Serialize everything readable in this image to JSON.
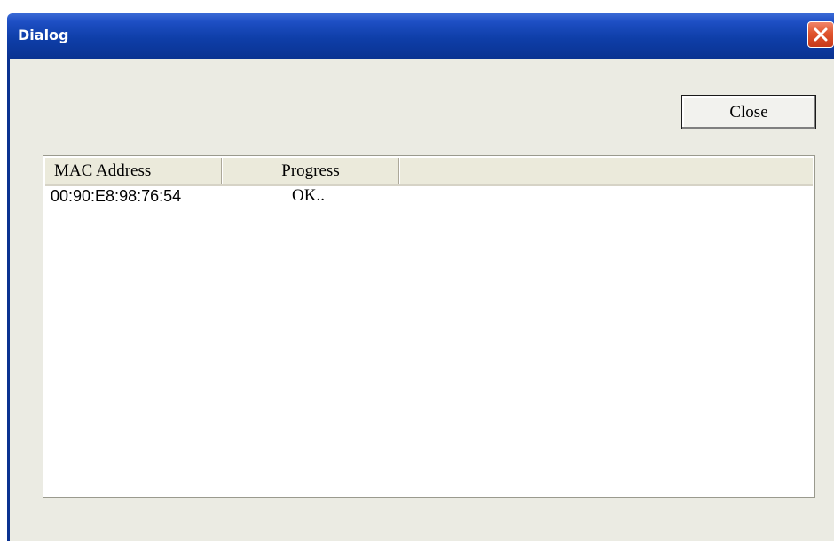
{
  "window": {
    "title": "Dialog",
    "close_icon": "close-x-icon",
    "colors": {
      "titlebar": "#0e3ea8",
      "close": "#e0542d",
      "client": "#ebebe3"
    }
  },
  "toolbar": {
    "close_label": "Close"
  },
  "table": {
    "columns": [
      "MAC Address",
      "Progress",
      ""
    ],
    "rows": [
      {
        "mac": "00:90:E8:98:76:54",
        "progress": "OK.."
      }
    ]
  }
}
